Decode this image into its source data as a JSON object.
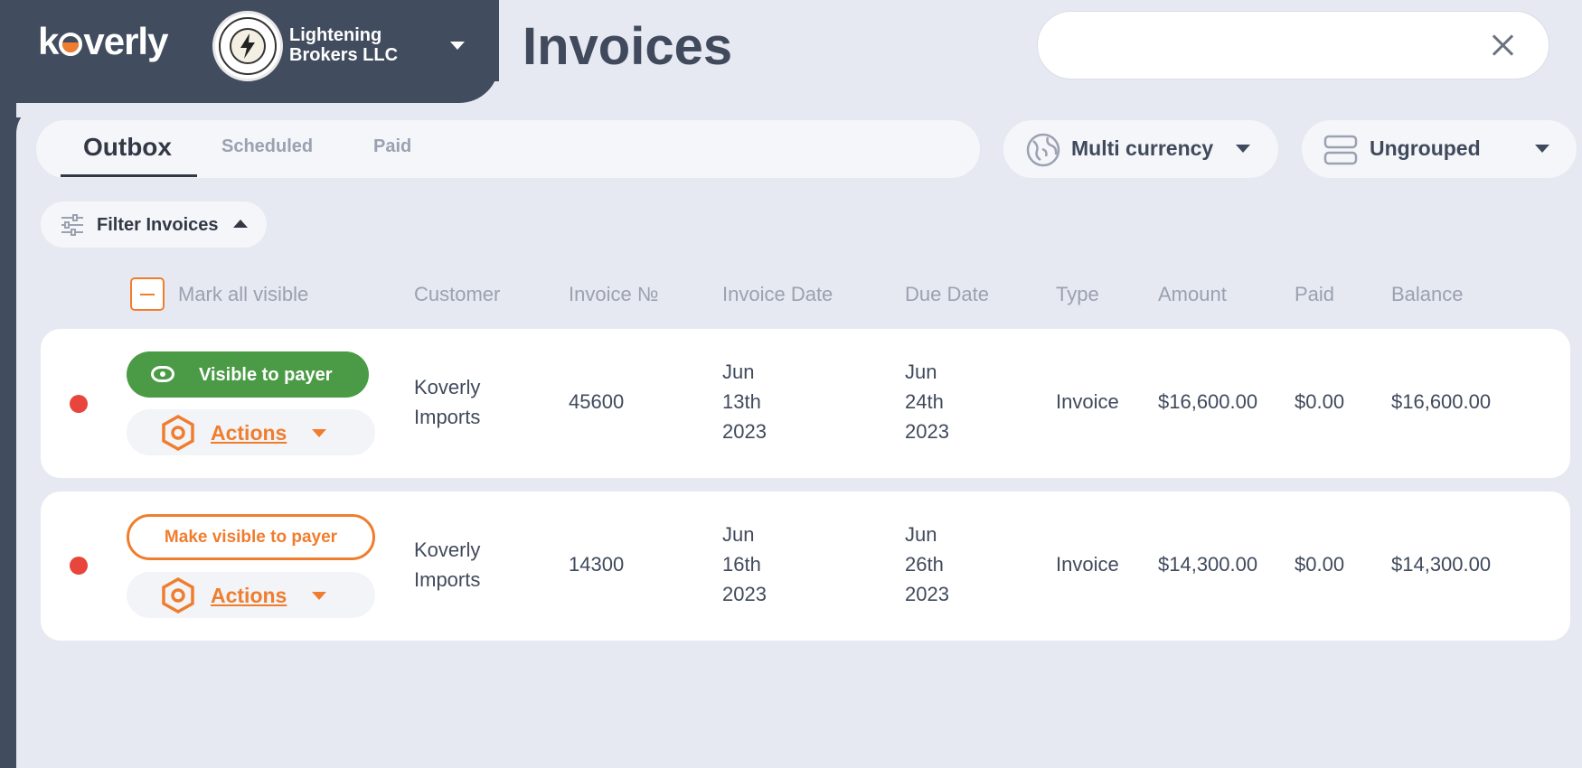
{
  "brand": {
    "logo_text_pre": "k",
    "logo_text_post": "verly"
  },
  "org": {
    "name_line1": "Lightening",
    "name_line2": "Brokers LLC",
    "seal_text": "LIGHTENING BROKERS"
  },
  "page": {
    "title": "Invoices"
  },
  "search": {
    "value": "",
    "placeholder": ""
  },
  "tabs": [
    {
      "label": "Outbox",
      "active": true
    },
    {
      "label": "Scheduled",
      "active": false
    },
    {
      "label": "Paid",
      "active": false
    }
  ],
  "currency": {
    "label": "Multi currency"
  },
  "grouping": {
    "label": "Ungrouped"
  },
  "filter": {
    "label": "Filter Invoices"
  },
  "table": {
    "mark_all_label": "Mark all visible",
    "headers": [
      "Customer",
      "Invoice №",
      "Invoice Date",
      "Due Date",
      "Type",
      "Amount",
      "Paid",
      "Balance"
    ],
    "rows": [
      {
        "status_color": "#e8453c",
        "visibility_label": "Visible to payer",
        "visible": true,
        "actions_label": "Actions",
        "customer_line1": "Koverly",
        "customer_line2": "Imports",
        "invoice_no": "45600",
        "invoice_date": [
          "Jun",
          "13th",
          "2023"
        ],
        "due_date": [
          "Jun",
          "24th",
          "2023"
        ],
        "type": "Invoice",
        "amount": "$16,600.00",
        "paid": "$0.00",
        "balance": "$16,600.00"
      },
      {
        "status_color": "#e8453c",
        "visibility_label": "Make visible to payer",
        "visible": false,
        "actions_label": "Actions",
        "customer_line1": "Koverly",
        "customer_line2": "Imports",
        "invoice_no": "14300",
        "invoice_date": [
          "Jun",
          "16th",
          "2023"
        ],
        "due_date": [
          "Jun",
          "26th",
          "2023"
        ],
        "type": "Invoice",
        "amount": "$14,300.00",
        "paid": "$0.00",
        "balance": "$14,300.00"
      }
    ]
  },
  "colors": {
    "accent": "#f07d2e",
    "success": "#4b9b46",
    "danger": "#e8453c",
    "nav_bg": "#414c5e",
    "page_bg": "#e6e9f1"
  }
}
